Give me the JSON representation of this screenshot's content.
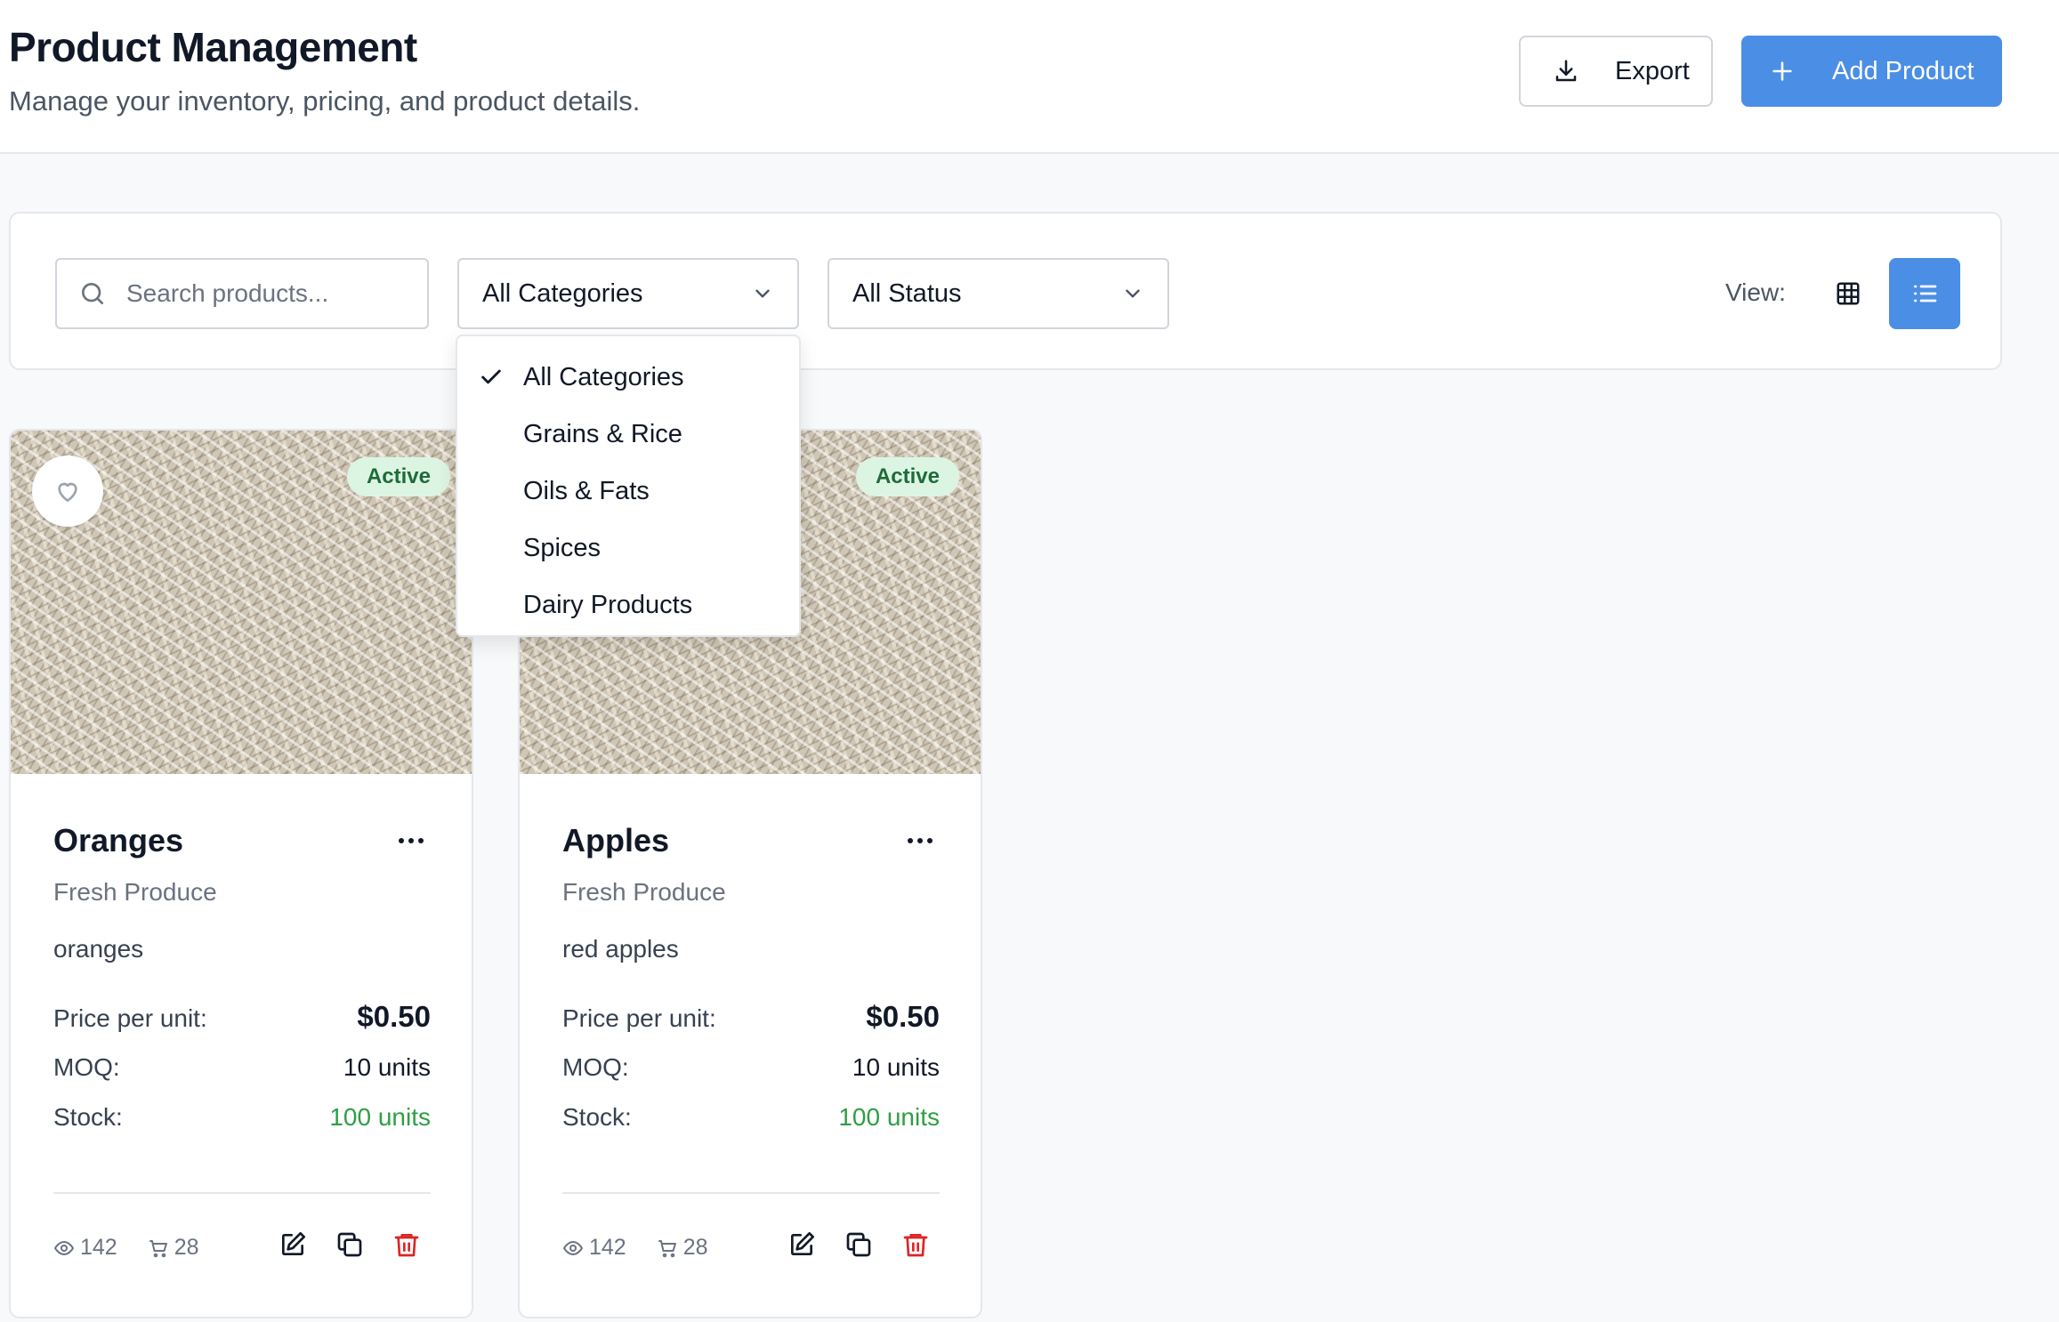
{
  "header": {
    "title": "Product Management",
    "subtitle": "Manage your inventory, pricing, and product details.",
    "export_label": "Export",
    "add_label": "Add Product"
  },
  "filters": {
    "search_placeholder": "Search products...",
    "category_selected": "All Categories",
    "status_selected": "All Status",
    "view_label": "View:",
    "category_options": [
      "All Categories",
      "Grains & Rice",
      "Oils & Fats",
      "Spices",
      "Dairy Products"
    ]
  },
  "labels": {
    "price": "Price per unit:",
    "moq": "MOQ:",
    "stock": "Stock:"
  },
  "products": [
    {
      "name": "Oranges",
      "category": "Fresh Produce",
      "description": "oranges",
      "status": "Active",
      "price": "$0.50",
      "moq": "10 units",
      "stock": "100 units",
      "views": "142",
      "orders": "28"
    },
    {
      "name": "Apples",
      "category": "Fresh Produce",
      "description": "red apples",
      "status": "Active",
      "price": "$0.50",
      "moq": "10 units",
      "stock": "100 units",
      "views": "142",
      "orders": "28"
    }
  ],
  "colors": {
    "primary": "#4a8ee6",
    "active_badge_bg": "#dcf5e3",
    "active_badge_text": "#1f6b3a",
    "stock_green": "#2f9e44",
    "delete_red": "#dc2626"
  }
}
